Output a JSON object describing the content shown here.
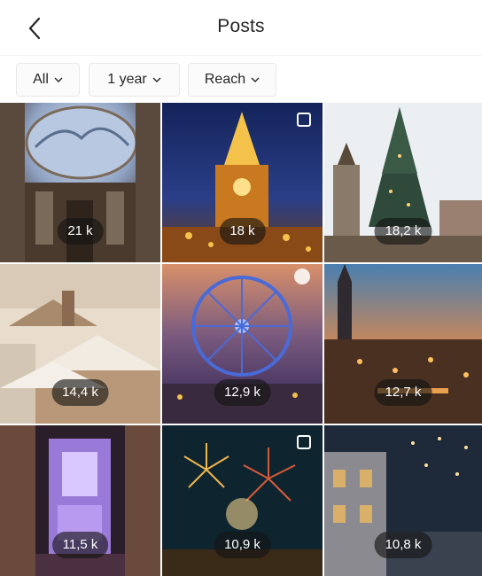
{
  "header": {
    "title": "Posts",
    "back_icon": "chevron-left-icon"
  },
  "filters": [
    {
      "label": "All",
      "icon": "chevron-down-icon"
    },
    {
      "label": "1 year",
      "icon": "chevron-down-icon"
    },
    {
      "label": "Reach",
      "icon": "chevron-down-icon"
    }
  ],
  "posts": [
    {
      "reach": "21 k",
      "multi": false,
      "scene": "ceiling-dome",
      "colors": [
        "#c9d6e8",
        "#5a6e8f",
        "#3b2e26"
      ]
    },
    {
      "reach": "18 k",
      "multi": true,
      "scene": "lit-church-night",
      "colors": [
        "#1d2f6b",
        "#c9791f",
        "#f4c24a"
      ]
    },
    {
      "reach": "18,2 k",
      "multi": false,
      "scene": "christmas-tree-square",
      "colors": [
        "#e9ecef",
        "#2f4a3a",
        "#8a6d5a"
      ]
    },
    {
      "reach": "14,4 k",
      "multi": false,
      "scene": "snowy-rooftops",
      "colors": [
        "#e8dccd",
        "#a88b6d",
        "#5b4a3c"
      ]
    },
    {
      "reach": "12,9 k",
      "multi": false,
      "scene": "ferris-wheel-dusk",
      "colors": [
        "#3a2f5e",
        "#d8906a",
        "#2a47b0"
      ]
    },
    {
      "reach": "12,7 k",
      "multi": false,
      "scene": "city-sunset-lights",
      "colors": [
        "#4a7fb0",
        "#d87a3a",
        "#3a2a20"
      ]
    },
    {
      "reach": "11,5 k",
      "multi": false,
      "scene": "purple-cathedral-interior",
      "colors": [
        "#2a1e2a",
        "#9a7ad8",
        "#6a4a3a"
      ]
    },
    {
      "reach": "10,9 k",
      "multi": true,
      "scene": "fireworks-night",
      "colors": [
        "#0e2530",
        "#f0b54a",
        "#d65a3a"
      ]
    },
    {
      "reach": "10,8 k",
      "multi": false,
      "scene": "christmas-street-lights",
      "colors": [
        "#1e2a3a",
        "#d8b06a",
        "#6a7a8a"
      ]
    }
  ]
}
